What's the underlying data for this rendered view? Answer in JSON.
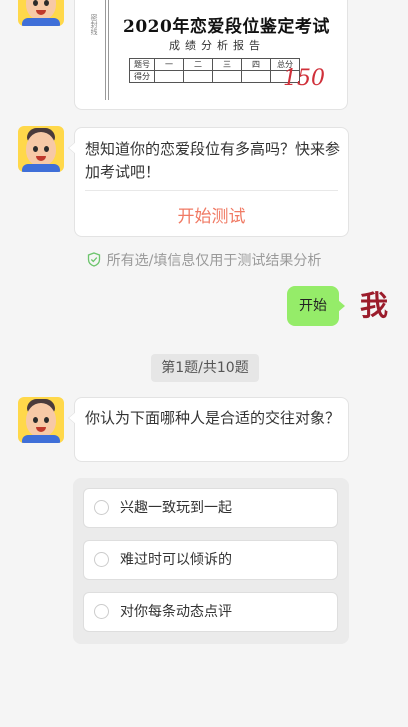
{
  "report": {
    "title": "2020年恋爱段位鉴定考试",
    "subtitle": "成绩分析报告",
    "side_text": "密封线",
    "table": {
      "row1": [
        "题号",
        "一",
        "二",
        "三",
        "四",
        "总分"
      ],
      "row2": [
        "得分",
        "",
        "",
        "",
        "",
        ""
      ]
    },
    "handwritten_score": "150"
  },
  "invite_message": {
    "text": "想知道你的恋爱段位有多高吗？快来参加考试吧！",
    "action_label": "开始测试",
    "action_color": "#f07a64"
  },
  "notice": {
    "icon": "shield-check-icon",
    "text": "所有选/填信息仅用于测试结果分析"
  },
  "user_message": {
    "text": "开始",
    "avatar_text": "我"
  },
  "progress": {
    "text": "第1题/共10题"
  },
  "question": {
    "text": "你认为下面哪种人是合适的交往对象？",
    "options": [
      {
        "label": "兴趣一致玩到一起"
      },
      {
        "label": "难过时可以倾诉的"
      },
      {
        "label": "对你每条动态点评"
      }
    ]
  },
  "colors": {
    "user_bubble": "#95ec69",
    "avatar_bg": "#ffd84a",
    "page_bg": "#f5f5f5"
  }
}
